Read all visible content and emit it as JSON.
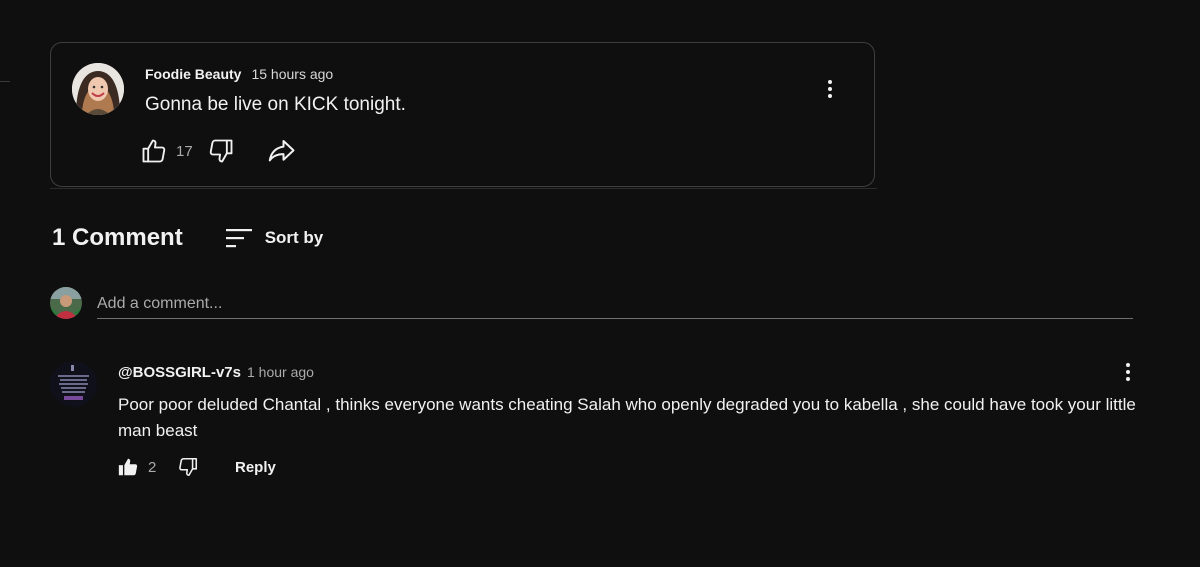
{
  "post": {
    "author": "Foodie Beauty",
    "time": "15 hours ago",
    "text": "Gonna be live on KICK tonight.",
    "like_count": "17",
    "icons": {
      "like": "thumbs-up-icon",
      "dislike": "thumbs-down-icon",
      "share": "share-icon",
      "menu": "more-vertical-icon"
    }
  },
  "comments_header": {
    "count_label": "1 Comment",
    "sort_label": "Sort by",
    "sort_icon": "sort-icon"
  },
  "add_comment": {
    "placeholder": "Add a comment..."
  },
  "comments": [
    {
      "author": "@BOSSGIRL-v7s",
      "time": "1 hour ago",
      "text": "Poor poor deluded Chantal , thinks everyone wants cheating Salah who openly degraded you to kabella , she could have took your little man beast",
      "like_count": "2",
      "reply_label": "Reply",
      "liked": true
    }
  ],
  "colors": {
    "background": "#0f0f0f",
    "text_primary": "#f1f1f1",
    "text_secondary": "#aaaaaa",
    "card_border": "#3f3f3f"
  }
}
